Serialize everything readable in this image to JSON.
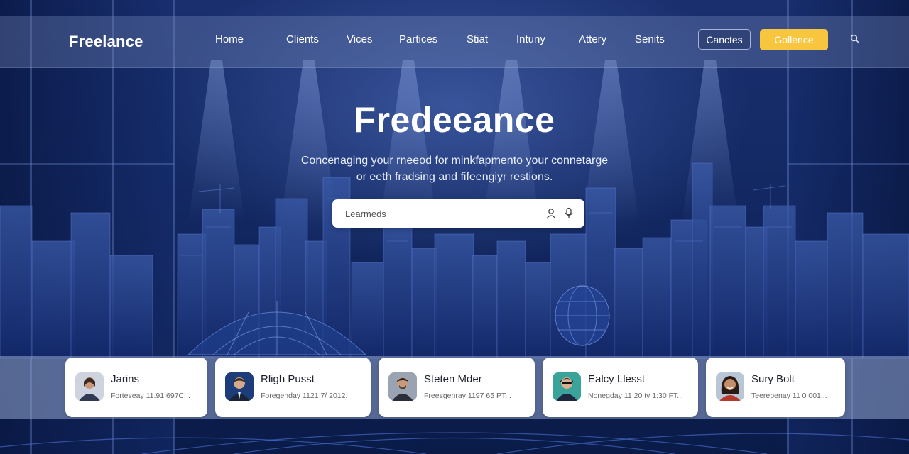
{
  "brand": {
    "logo": "Freelance"
  },
  "nav": {
    "links": [
      "Home",
      "Clients",
      "Vices",
      "Partices",
      "Stiat",
      "Intuny",
      "Attery",
      "Senits"
    ],
    "outline_button": "Canctes",
    "primary_button": "Gollence",
    "search_icon": "search-icon"
  },
  "hero": {
    "title": "Fredeeance",
    "subtitle_line1": "Concenaging your rneeod for minkfapmento your connetarge",
    "subtitle_line2": "or  eeth fradsing and fifeengiyr restions."
  },
  "search": {
    "placeholder": "Learmeds",
    "icons": [
      "user-icon",
      "microphone-icon"
    ]
  },
  "profiles": [
    {
      "name": "Jarins",
      "meta": "Forteseay 11.91 697C...",
      "avatar_color": "#6b4a3a"
    },
    {
      "name": "Rligh Pusst",
      "meta": "Foregenday 1121 7/ 2012.",
      "avatar_color": "#2b3a5a"
    },
    {
      "name": "Steten Mder",
      "meta": "Freesgenray 1197 65 PT...",
      "avatar_color": "#4a3b33"
    },
    {
      "name": "Ealcy Llesst",
      "meta": "Nonegday 11 20 ty 1:30 FT...",
      "avatar_color": "#1e2a3e"
    },
    {
      "name": "Sury Bolt",
      "meta": "Teerepenay 11 0 001...",
      "avatar_color": "#7a3b2e"
    }
  ],
  "colors": {
    "accent": "#f8c53e",
    "background": "#0d1f52",
    "nav_bar": "#7a8cbe"
  }
}
